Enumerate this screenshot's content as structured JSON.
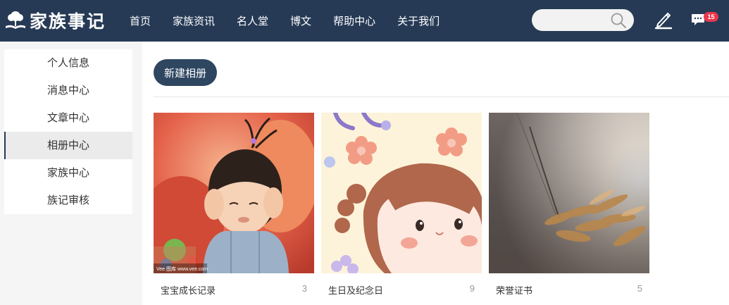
{
  "header": {
    "logo_text": "家族事记",
    "nav": [
      "首页",
      "家族资讯",
      "名人堂",
      "博文",
      "帮助中心",
      "关于我们"
    ],
    "search": {
      "value": "",
      "placeholder": ""
    },
    "message_count": "15"
  },
  "sidebar": {
    "items": [
      "个人信息",
      "消息中心",
      "文章中心",
      "相册中心",
      "家族中心",
      "族记审核"
    ],
    "active": "相册中心"
  },
  "main": {
    "new_album_label": "新建相册",
    "albums": [
      {
        "name": "宝宝成长记录",
        "count": "3",
        "watermark": "Vee 图库 www.vee.com"
      },
      {
        "name": "生日及纪念日",
        "count": "9"
      },
      {
        "name": "荣誉证书",
        "count": "5"
      }
    ]
  },
  "colors": {
    "header_bg": "#263a55",
    "button_bg": "#2e4660",
    "badge": "#e8374c"
  }
}
